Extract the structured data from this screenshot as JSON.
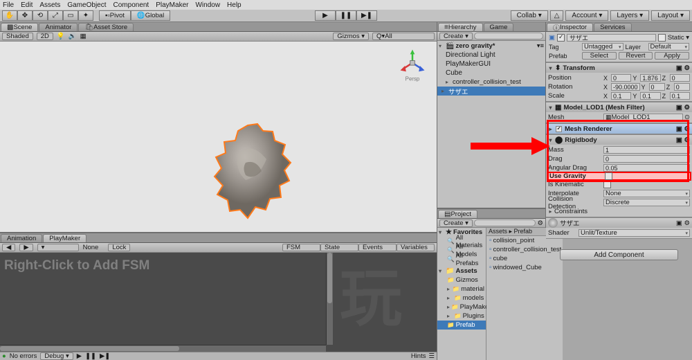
{
  "menu": {
    "items": [
      "File",
      "Edit",
      "Assets",
      "GameObject",
      "Component",
      "PlayMaker",
      "Window",
      "Help"
    ]
  },
  "toolbar": {
    "pivot": "Pivot",
    "global": "Global",
    "right": [
      "Collab ▾",
      "△",
      "Account ▾",
      "Layers ▾",
      "Layout ▾"
    ]
  },
  "scene": {
    "tabs": [
      "Scene",
      "Animator",
      "Asset Store"
    ],
    "strip": {
      "shaded": "Shaded",
      "twoD": "2D",
      "gizmos": "Gizmos ▾",
      "qall": "Q▾All"
    },
    "gizmo_label": "Persp"
  },
  "lower": {
    "tabs": [
      "Animation",
      "PlayMaker"
    ],
    "strip": {
      "lock": "Lock",
      "fsm": "FSM",
      "state": "State",
      "events": "Events",
      "variables": "Variables"
    },
    "hint": "Right-Click to Add FSM",
    "watermark": "玩",
    "footer": {
      "errors": "No errors",
      "debug": "Debug ▾",
      "hints": "Hints"
    }
  },
  "hierarchy": {
    "tabs": [
      "Hierarchy",
      "Game"
    ],
    "create": "Create ▾",
    "scene": "zero gravity*",
    "items": [
      "Directional Light",
      "PlayMakerGUI",
      "Cube",
      "controller_collision_test",
      "サザエ"
    ]
  },
  "project": {
    "tab": "Project",
    "create": "Create ▾",
    "favorites": "Favorites",
    "fav_items": [
      "All Materials",
      "All Models",
      "All Prefabs"
    ],
    "assets": "Assets",
    "asset_folders": [
      "Gizmos",
      "material",
      "models",
      "PlayMaker",
      "Plugins",
      "Prefab"
    ],
    "breadcrumb": "Assets ▸ Prefab",
    "files": [
      "collision_point",
      "controller_collision_test",
      "cube",
      "windowed_Cube"
    ]
  },
  "inspector": {
    "tabs": [
      "Inspector",
      "Services"
    ],
    "name": "サザエ",
    "static": "Static ▾",
    "tag_label": "Tag",
    "tag": "Untagged",
    "layer_label": "Layer",
    "layer": "Default",
    "prefab_label": "Prefab",
    "select": "Select",
    "revert": "Revert",
    "apply": "Apply",
    "transform": {
      "title": "Transform",
      "position": {
        "label": "Position",
        "x": "0",
        "y": "1.876",
        "z": "0"
      },
      "rotation": {
        "label": "Rotation",
        "x": "-90.0000",
        "y": "0",
        "z": "0"
      },
      "scale": {
        "label": "Scale",
        "x": "0.1",
        "y": "0.1",
        "z": "0.1"
      }
    },
    "mesh_filter": {
      "title": "Model_LOD1 (Mesh Filter)",
      "mesh_label": "Mesh",
      "mesh": "Model_LOD1"
    },
    "mesh_renderer": {
      "title": "Mesh Renderer"
    },
    "rigidbody": {
      "title": "Rigidbody",
      "mass": {
        "label": "Mass",
        "v": "1"
      },
      "drag": {
        "label": "Drag",
        "v": "0"
      },
      "ang": {
        "label": "Angular Drag",
        "v": "0.05"
      },
      "grav": {
        "label": "Use Gravity"
      },
      "kin": {
        "label": "Is Kinematic"
      },
      "interp": {
        "label": "Interpolate",
        "v": "None"
      },
      "coll": {
        "label": "Collision Detection",
        "v": "Discrete"
      },
      "constraints": "Constraints"
    },
    "material": {
      "name": "サザエ",
      "shader_label": "Shader",
      "shader": "Unlit/Texture"
    },
    "add": "Add Component"
  }
}
